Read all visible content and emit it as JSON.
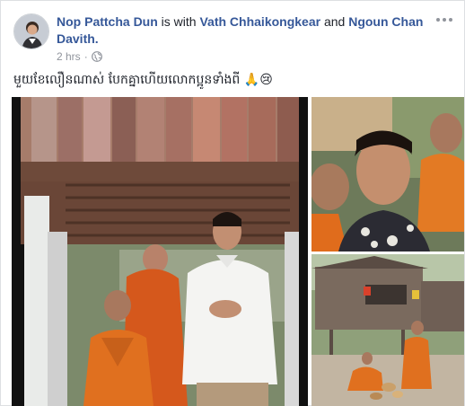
{
  "post": {
    "author": "Nop Pattcha Dun",
    "with_text": "is with",
    "tagged_1": "Vath Chhaikongkear",
    "and_text": "and",
    "tagged_2": "Ngoun Chan Davith.",
    "time": "2 hrs",
    "time_separator": "·",
    "privacy_icon": "globe-icon",
    "more_icon": "more-options-icon",
    "caption": "មួយខែលឿនណាស់ បែកគ្នាហើយលោកប្អូនទាំងពី 🙏😢"
  },
  "colors": {
    "link": "#365899",
    "meta": "#90949c",
    "monk_robe": "#e0701f",
    "shirt": "#f4f4f2"
  }
}
